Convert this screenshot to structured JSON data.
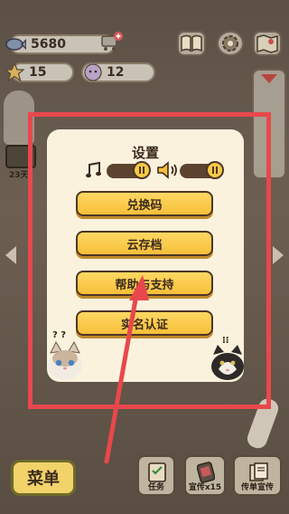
{
  "hud": {
    "fish_count": "5680",
    "star_count": "15",
    "coin_count": "12"
  },
  "dialog": {
    "title": "设置",
    "buttons": [
      {
        "label": "兑换码"
      },
      {
        "label": "云存档"
      },
      {
        "label": "帮助与支持"
      },
      {
        "label": "实名认证"
      }
    ]
  },
  "side": {
    "day_label": "23天"
  },
  "bottom_bar": {
    "menu_label": "菜单",
    "task_label": "任务",
    "promo_label": "宣传x15",
    "flyer_label": "传单宣传"
  },
  "cats": {
    "left_mark": "? ?",
    "right_mark": "⁝⁝"
  },
  "colors": {
    "accent": "#f6bf3a",
    "annotation": "#e8484c",
    "dialog_bg": "#fbf2de"
  }
}
